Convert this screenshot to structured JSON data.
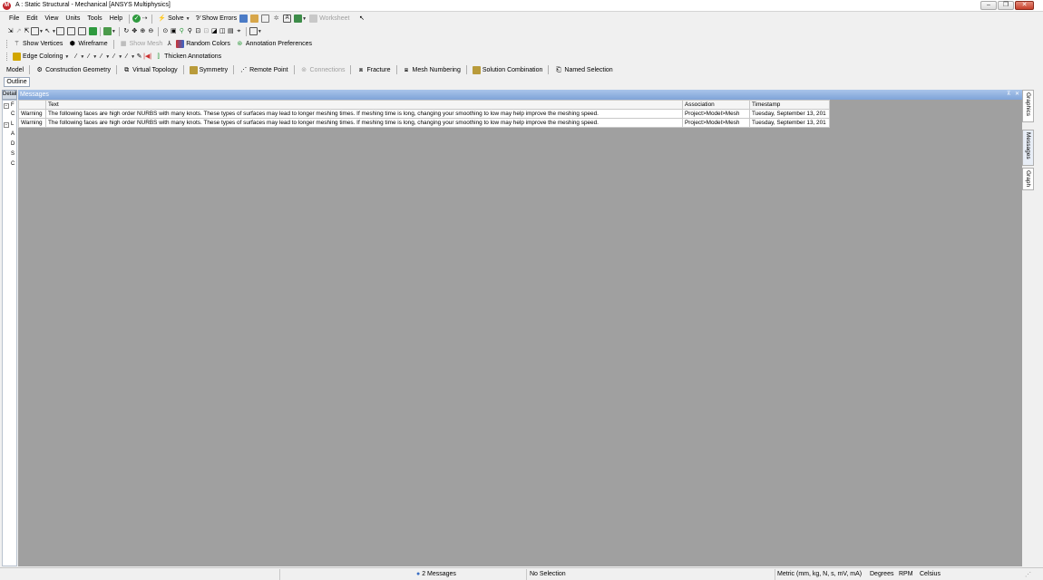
{
  "window": {
    "title": "A : Static Structural - Mechanical [ANSYS Multiphysics]",
    "app_icon_letter": "M",
    "controls": [
      "minimize",
      "restore",
      "close"
    ]
  },
  "menu": [
    "File",
    "Edit",
    "View",
    "Units",
    "Tools",
    "Help"
  ],
  "standard_toolbar": {
    "solve_label": "Solve",
    "show_errors_label": "Show Errors",
    "worksheet_label": "Worksheet"
  },
  "graphics_options_toolbar": {
    "show_vertices": "Show Vertices",
    "wireframe": "Wireframe",
    "show_mesh": "Show Mesh",
    "random_colors": "Random Colors",
    "annotation_preferences": "Annotation Preferences"
  },
  "edge_toolbar": {
    "edge_coloring": "Edge Coloring",
    "thicken_annotations": "Thicken Annotations"
  },
  "context_toolbar": {
    "model": "Model",
    "construction_geometry": "Construction Geometry",
    "virtual_topology": "Virtual Topology",
    "symmetry": "Symmetry",
    "remote_point": "Remote Point",
    "connections": "Connections",
    "fracture": "Fracture",
    "mesh_numbering": "Mesh Numbering",
    "solution_combination": "Solution Combination",
    "named_selection": "Named Selection"
  },
  "outline_tab": "Outline",
  "details_tab": "Details",
  "details_letters": [
    "F",
    "C",
    "L",
    "A",
    "D",
    "S",
    "C"
  ],
  "messages": {
    "title": "Messages",
    "columns": [
      "Text",
      "Association",
      "Timestamp"
    ],
    "rows": [
      {
        "type": "Warning",
        "text": "The following faces are high order NURBS with many knots. These types of surfaces may lead to longer meshing times. If meshing time is long, changing your smoothing to low may help improve the meshing speed.",
        "association": "Project>Model>Mesh",
        "timestamp": "Tuesday, September 13, 201"
      },
      {
        "type": "Warning",
        "text": "The following faces are high order NURBS with many knots. These types of surfaces may lead to longer meshing times. If meshing time is long, changing your smoothing to low may help improve the meshing speed.",
        "association": "Project>Model>Mesh",
        "timestamp": "Tuesday, September 13, 201"
      }
    ]
  },
  "right_tabs": [
    "Graphics",
    "Messages",
    "Graph"
  ],
  "status": {
    "messages": "2 Messages",
    "selection": "No Selection",
    "units": "Metric (mm, kg, N, s, mV, mA)",
    "angle": "Degrees",
    "rotational": "RPM",
    "temperature": "Celsius"
  },
  "colors": {
    "accent": "#7fa3d8",
    "background_gray": "#a0a0a0",
    "close_button": "#c7402b",
    "app_icon": "#c1272d"
  }
}
